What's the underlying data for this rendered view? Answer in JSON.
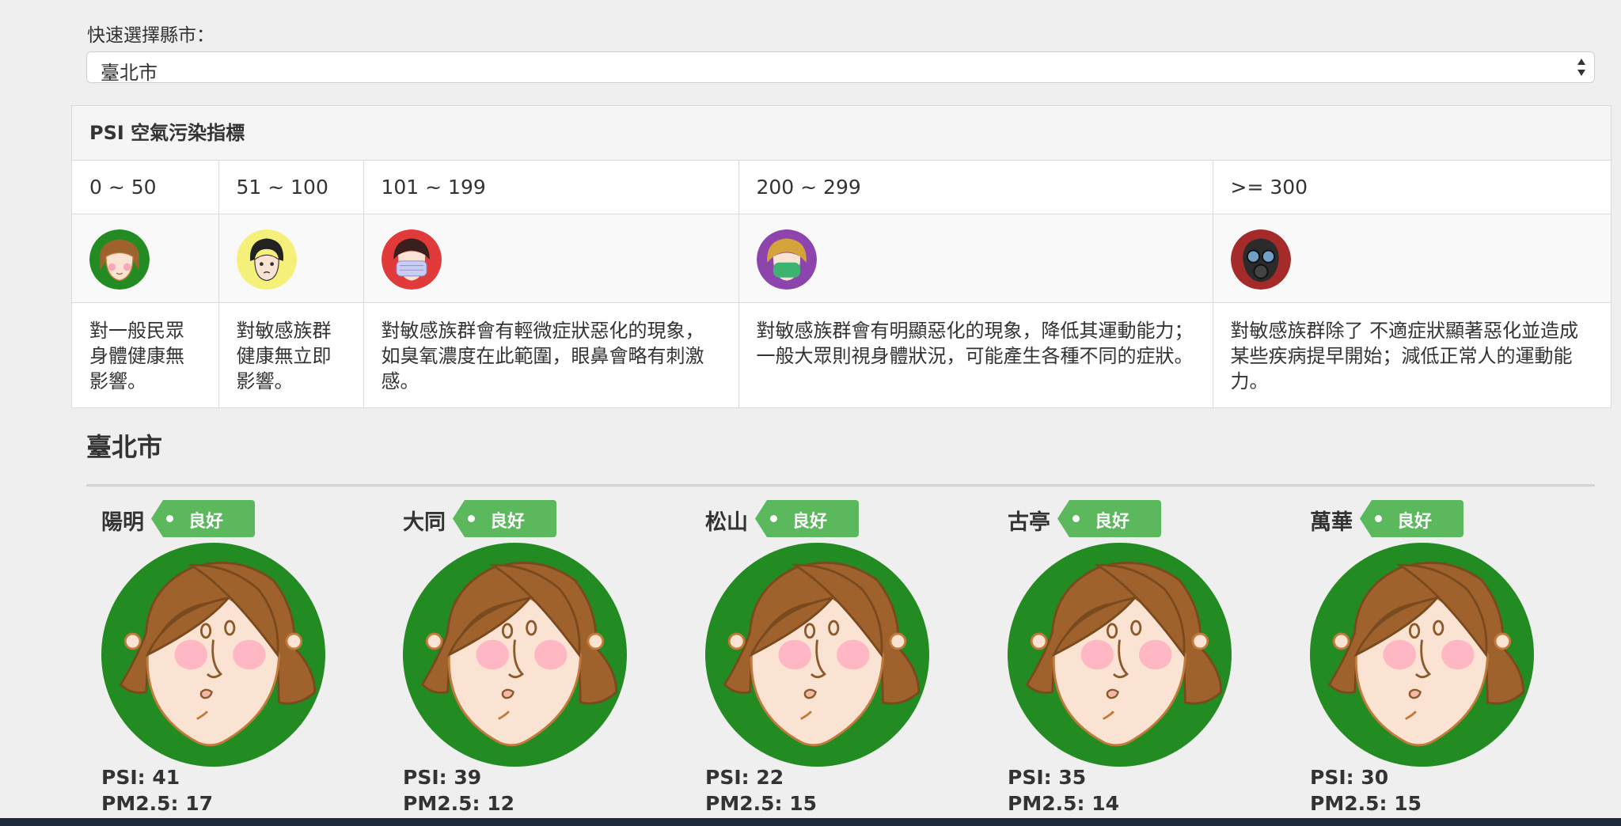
{
  "quick_select": {
    "label": "快速選擇縣市：",
    "value": "臺北市"
  },
  "psi_panel": {
    "title": "PSI 空氣污染指標",
    "levels": [
      {
        "range": "0 ~ 50",
        "icon": "green-face-icon",
        "color": "#228b22",
        "description": "對一般民眾身體健康無影響。"
      },
      {
        "range": "51 ~ 100",
        "icon": "yellow-face-icon",
        "color": "#f5f07a",
        "description": "對敏感族群健康無立即影響。"
      },
      {
        "range": "101 ~ 199",
        "icon": "red-mask-face-icon",
        "color": "#e03a3a",
        "description": "對敏感族群會有輕微症狀惡化的現象，如臭氧濃度在此範圍，眼鼻會略有刺激感。"
      },
      {
        "range": "200 ~ 299",
        "icon": "purple-mask-face-icon",
        "color": "#8e44ad",
        "description": "對敏感族群會有明顯惡化的現象，降低其運動能力；一般大眾則視身體狀況，可能產生各種不同的症狀。"
      },
      {
        "range": ">= 300",
        "icon": "gas-mask-face-icon",
        "color": "#a52a2a",
        "description": "對敏感族群除了 不適症狀顯著惡化並造成某些疾病提早開始；減低正常人的運動能力。"
      }
    ]
  },
  "area": {
    "title": "臺北市",
    "stations": [
      {
        "name": "陽明",
        "status": "良好",
        "psi": "PSI: 41",
        "pm25": "PM2.5: 17"
      },
      {
        "name": "大同",
        "status": "良好",
        "psi": "PSI: 39",
        "pm25": "PM2.5: 12"
      },
      {
        "name": "松山",
        "status": "良好",
        "psi": "PSI: 22",
        "pm25": "PM2.5: 15"
      },
      {
        "name": "古亭",
        "status": "良好",
        "psi": "PSI: 35",
        "pm25": "PM2.5: 14"
      },
      {
        "name": "萬華",
        "status": "良好",
        "psi": "PSI: 30",
        "pm25": "PM2.5: 15"
      }
    ]
  },
  "colors": {
    "good_badge": "#5cb85c",
    "face_ring_good": "#228b22"
  }
}
